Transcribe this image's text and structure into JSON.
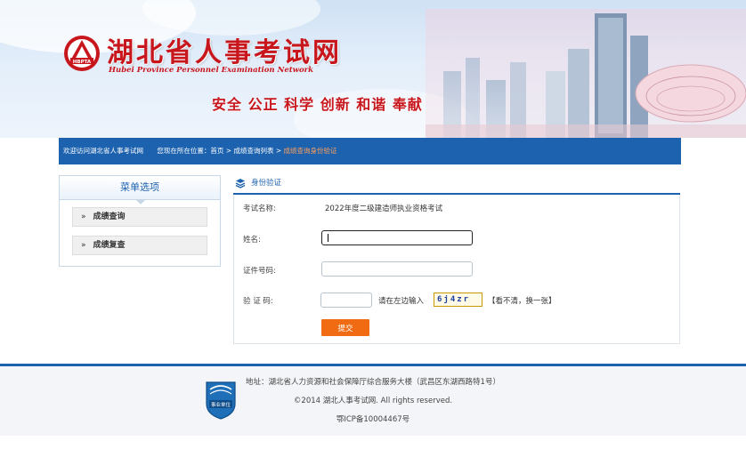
{
  "header": {
    "title": "湖北省人事考试网",
    "subtitle": "Hubei Province Personnel Examination Network",
    "logo_text": "HBPTA",
    "slogan": "安全 公正 科学 创新 和谐 奉献"
  },
  "nav": {
    "welcome": "欢迎访问湖北省人事考试网",
    "position_label": "您现在所在位置：",
    "crumb_home": "首页",
    "crumb_list": "成绩查询列表",
    "crumb_current": "成绩查询身份验证",
    "separator": " > "
  },
  "sidebar": {
    "title": "菜单选项",
    "items": [
      {
        "label": "成绩查询",
        "arrow": "»"
      },
      {
        "label": "成绩复查",
        "arrow": "»"
      }
    ]
  },
  "panel": {
    "title": "身份验证"
  },
  "form": {
    "exam_label": "考试名称:",
    "exam_value": "2022年度二级建造师执业资格考试",
    "name_label": "姓名:",
    "name_value": "",
    "id_label": "证件号码:",
    "id_value": "",
    "captcha_label": "验 证 码:",
    "captcha_value": "",
    "captcha_hint": "请在左边输入",
    "captcha_code": "6j4zr",
    "captcha_refresh": "【看不清，换一张】",
    "submit_label": "提交"
  },
  "footer": {
    "address": "地址：湖北省人力资源和社会保障厅综合服务大楼（武昌区东湖西路特1号）",
    "copyright": "©2014 湖北人事考试网. All rights reserved.",
    "icp": "鄂ICP备10004467号",
    "emblem_text": "事业单位"
  },
  "colors": {
    "brand_red": "#c8161d",
    "nav_blue": "#1d62ae",
    "submit_orange": "#f06b12",
    "crumb_current": "#ff9f5a"
  }
}
